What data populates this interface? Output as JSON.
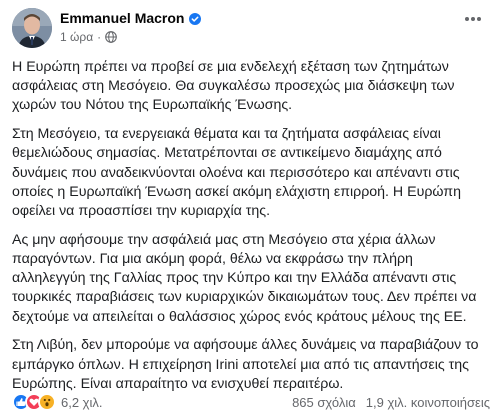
{
  "post": {
    "author": "Emmanuel Macron",
    "timestamp": "1 ώρα",
    "audience_icon": "globe-icon",
    "more_icon": "more-horizontal-icon",
    "paragraphs": [
      "Η Ευρώπη πρέπει να προβεί σε μια ενδελεχή εξέταση των ζητημάτων ασφάλειας στη Μεσόγειο. Θα συγκαλέσω προσεχώς μια διάσκεψη των χωρών του Νότου της Ευρωπαϊκής Ένωσης.",
      "Στη Μεσόγειο, τα ενεργειακά θέματα και τα ζητήματα ασφάλειας είναι θεμελιώδους σημασίας. Μετατρέπονται σε αντικείμενο διαμάχης από δυνάμεις που αναδεικνύονται ολοένα και περισσότερο και απέναντι στις οποίες η Ευρωπαϊκή Ένωση ασκεί ακόμη ελάχιστη επιρροή. Η Ευρώπη οφείλει να προασπίσει την κυριαρχία της.",
      "Ας μην αφήσουμε την ασφάλειά μας στη Μεσόγειο στα χέρια άλλων παραγόντων. Για μια ακόμη φορά, θέλω να εκφράσω την πλήρη αλληλεγγύη της Γαλλίας προς την Κύπρο και την Ελλάδα απέναντι στις τουρκικές παραβιάσεις των κυριαρχικών δικαιωμάτων τους. Δεν πρέπει να δεχτούμε να απειλείται ο θαλάσσιος χώρος ενός κράτους μέλους της ΕΕ.",
      "Στη Λιβύη, δεν μπορούμε να αφήσουμε άλλες δυνάμεις να παραβιάζουν το εμπάργκο όπλων. Η επιχείρηση Irini αποτελεί μια από τις απαντήσεις της Ευρώπης. Είναι απαραίτητο να ενισχυθεί περαιτέρω."
    ],
    "reactions": {
      "icons": [
        "like-icon",
        "love-icon",
        "wow-icon"
      ],
      "count": "6,2 χιλ."
    },
    "comments": "865 σχόλια",
    "shares": "1,9 χιλ. κοινοποιήσεις"
  },
  "colors": {
    "text": "#1c1e21",
    "secondary": "#65676b",
    "verified": "#1877f2",
    "like": "#1877f2",
    "love": "#f33e58",
    "wow": "#f7b125"
  }
}
